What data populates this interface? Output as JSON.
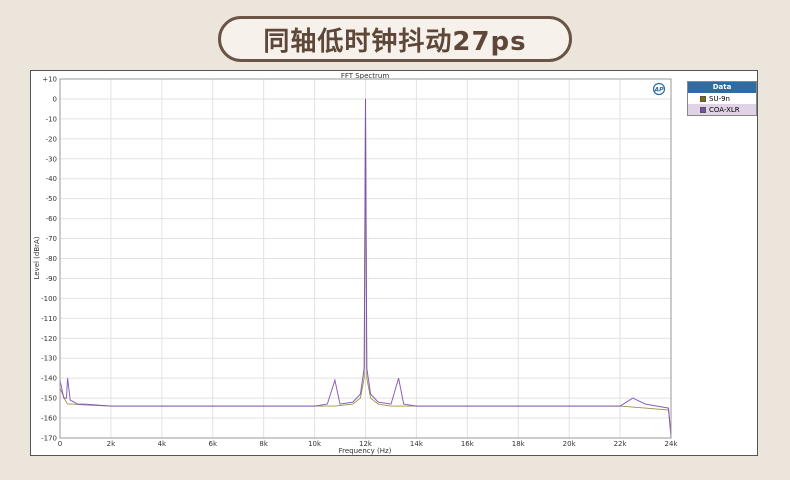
{
  "banner": {
    "title": "同轴低时钟抖动27ps"
  },
  "colors": {
    "su9n": "#7a7000",
    "coa_xlr": "#7b4fb8"
  },
  "chart_data": {
    "type": "line",
    "title": "FFT Spectrum",
    "xlabel": "Frequency (Hz)",
    "ylabel": "Level (dBrA)",
    "xlim": [
      0,
      24000
    ],
    "ylim": [
      -170,
      10
    ],
    "grid": true,
    "logo": "AP",
    "legend_title": "Data",
    "legend_position": "right",
    "x_ticks": [
      {
        "value": 0,
        "label": "0"
      },
      {
        "value": 2000,
        "label": "2k"
      },
      {
        "value": 4000,
        "label": "4k"
      },
      {
        "value": 6000,
        "label": "6k"
      },
      {
        "value": 8000,
        "label": "8k"
      },
      {
        "value": 10000,
        "label": "10k"
      },
      {
        "value": 12000,
        "label": "12k"
      },
      {
        "value": 14000,
        "label": "14k"
      },
      {
        "value": 16000,
        "label": "16k"
      },
      {
        "value": 18000,
        "label": "18k"
      },
      {
        "value": 20000,
        "label": "20k"
      },
      {
        "value": 22000,
        "label": "22k"
      },
      {
        "value": 24000,
        "label": "24k"
      }
    ],
    "y_ticks": [
      {
        "value": 10,
        "label": "+10"
      },
      {
        "value": 0,
        "label": "0"
      },
      {
        "value": -10,
        "label": "-10"
      },
      {
        "value": -20,
        "label": "-20"
      },
      {
        "value": -30,
        "label": "-30"
      },
      {
        "value": -40,
        "label": "-40"
      },
      {
        "value": -50,
        "label": "-50"
      },
      {
        "value": -60,
        "label": "-60"
      },
      {
        "value": -70,
        "label": "-70"
      },
      {
        "value": -80,
        "label": "-80"
      },
      {
        "value": -90,
        "label": "-90"
      },
      {
        "value": -100,
        "label": "-100"
      },
      {
        "value": -110,
        "label": "-110"
      },
      {
        "value": -120,
        "label": "-120"
      },
      {
        "value": -130,
        "label": "-130"
      },
      {
        "value": -140,
        "label": "-140"
      },
      {
        "value": -150,
        "label": "-150"
      },
      {
        "value": -160,
        "label": "-160"
      },
      {
        "value": -170,
        "label": "-170"
      }
    ],
    "series": [
      {
        "name": "SU-9n",
        "color": "#7a7000",
        "x": [
          0,
          200,
          300,
          500,
          1000,
          2000,
          4000,
          6000,
          8000,
          10000,
          10800,
          11500,
          11800,
          11950,
          12000,
          12050,
          12200,
          12500,
          13000,
          13300,
          14000,
          16000,
          18000,
          20000,
          22000,
          23000,
          23900,
          24000
        ],
        "y": [
          -145,
          -151,
          -153,
          -153,
          -153.5,
          -154,
          -154,
          -154,
          -154,
          -154,
          -154,
          -153,
          -150,
          -140,
          0,
          -140,
          -150,
          -153,
          -154,
          -154,
          -154,
          -154,
          -154,
          -154,
          -154,
          -155,
          -156,
          -168
        ]
      },
      {
        "name": "COA-XLR",
        "color": "#7b4fb8",
        "x": [
          0,
          150,
          250,
          300,
          400,
          700,
          1000,
          2000,
          4000,
          6000,
          8000,
          10000,
          10500,
          10800,
          11000,
          11500,
          11800,
          11950,
          12000,
          12050,
          12200,
          12500,
          13000,
          13300,
          13500,
          14000,
          16000,
          18000,
          20000,
          22000,
          22500,
          23000,
          23900,
          24000
        ],
        "y": [
          -141,
          -150,
          -150,
          -140,
          -151,
          -153,
          -153,
          -154,
          -154,
          -154,
          -154,
          -154,
          -153,
          -141,
          -153,
          -152,
          -148,
          -135,
          0,
          -135,
          -148,
          -152,
          -153,
          -140,
          -153,
          -154,
          -154,
          -154,
          -154,
          -154,
          -150,
          -153,
          -155,
          -170
        ]
      }
    ]
  }
}
